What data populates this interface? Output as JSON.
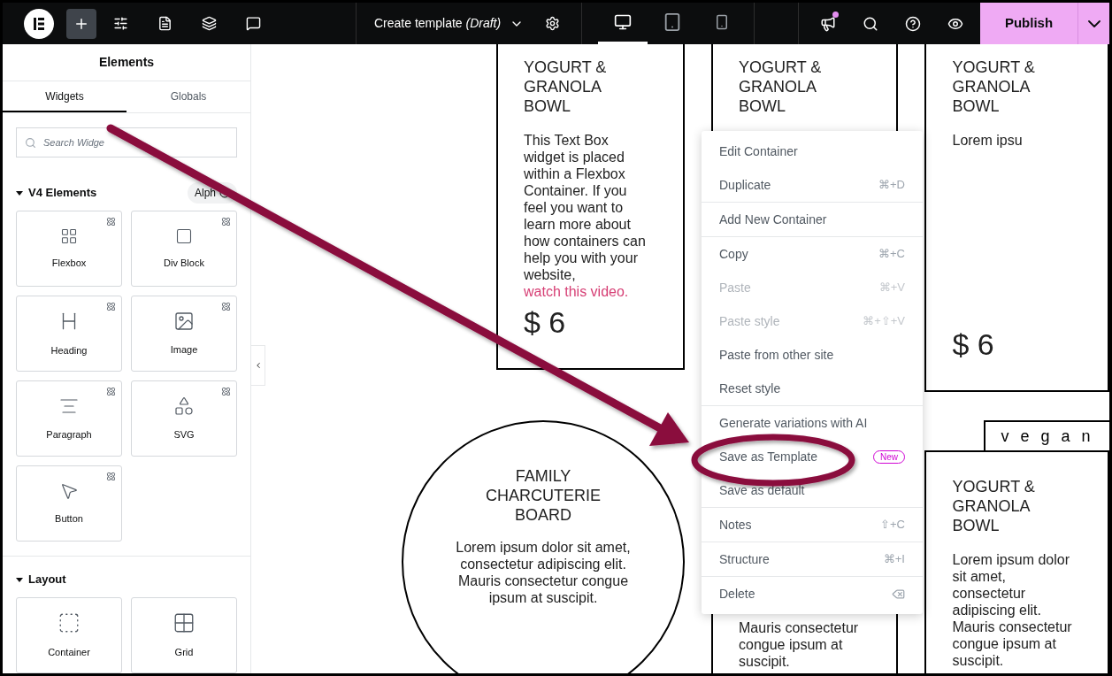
{
  "toolbar": {
    "add_button": {
      "selected": true
    },
    "title": "Create template",
    "status": "(Draft)",
    "devices": [
      {
        "kind": "desktop",
        "selected": true
      },
      {
        "kind": "tablet",
        "selected": false
      },
      {
        "kind": "mobile",
        "selected": false
      }
    ],
    "whats_new": {
      "has_notification": true
    },
    "publish": "Publish"
  },
  "sidebar": {
    "title": "Elements",
    "tabs": [
      {
        "label": "Widgets",
        "selected": true
      },
      {
        "label": "Globals",
        "selected": false
      }
    ],
    "search": {
      "placeholder": "Search Widge"
    },
    "sections": [
      {
        "title": "V4 Elements",
        "expanded": true,
        "badge": "Alph",
        "widgets": [
          {
            "label": "Flexbox",
            "kind": "flexbox",
            "atomic": true
          },
          {
            "label": "Div Block",
            "kind": "div-block",
            "atomic": true
          },
          {
            "label": "Heading",
            "kind": "heading",
            "atomic": true
          },
          {
            "label": "Image",
            "kind": "image",
            "atomic": true
          },
          {
            "label": "Paragraph",
            "kind": "paragraph",
            "atomic": true
          },
          {
            "label": "SVG",
            "kind": "svg",
            "atomic": true
          },
          {
            "label": "Button",
            "kind": "button",
            "atomic": true
          }
        ]
      },
      {
        "title": "Layout",
        "expanded": true,
        "widgets": [
          {
            "label": "Container",
            "kind": "container",
            "atomic": false
          },
          {
            "label": "Grid",
            "kind": "grid",
            "atomic": false
          }
        ]
      }
    ]
  },
  "canvas": {
    "columns": [
      [
        {
          "kind": "card",
          "title": "YOGURT & GRANOLA BOWL",
          "body": "This Text Box widget is placed within a Flexbox Container. If you feel you want to learn more about how containers can help you with your website,",
          "link": "watch this video.",
          "price": "$ 6"
        },
        {
          "kind": "circle",
          "title": "FAMILY CHARCUTERIE BOARD",
          "body": "Lorem ipsum dolor sit amet, consectetur adipiscing elit. Mauris consectetur congue ipsum at suscipit."
        }
      ],
      [
        {
          "kind": "card",
          "title": "YOGURT & GRANOLA BOWL"
        },
        {
          "kind": "card",
          "body": "Mauris consectetur congue ipsum at suscipit."
        }
      ],
      [
        {
          "kind": "card",
          "title": "YOGURT & GRANOLA BOWL",
          "body": "Lorem ipsu",
          "price": "$ 6"
        },
        {
          "kind": "tag",
          "text": "v e g a n"
        },
        {
          "kind": "card",
          "title": "YOGURT & GRANOLA BOWL",
          "body": "Lorem ipsum dolor sit amet, consectetur adipiscing elit. Mauris consectetur congue ipsum at suscipit."
        }
      ]
    ]
  },
  "context_menu": {
    "groups": [
      [
        {
          "label": "Edit Container",
          "disabled": false
        },
        {
          "label": "Duplicate",
          "shortcut": "⌘+D",
          "disabled": false
        }
      ],
      [
        {
          "label": "Add New Container",
          "disabled": false
        }
      ],
      [
        {
          "label": "Copy",
          "shortcut": "⌘+C",
          "disabled": false
        },
        {
          "label": "Paste",
          "shortcut": "⌘+V",
          "disabled": true
        },
        {
          "label": "Paste style",
          "shortcut": "⌘+⇧+V",
          "disabled": true
        },
        {
          "label": "Paste from other site",
          "disabled": false
        },
        {
          "label": "Reset style",
          "disabled": false
        }
      ],
      [
        {
          "label": "Generate variations with AI",
          "disabled": false
        },
        {
          "label": "Save as Template",
          "badge": "New",
          "disabled": false
        },
        {
          "label": "Save as default",
          "disabled": false
        }
      ],
      [
        {
          "label": "Notes",
          "shortcut": "⇧+C",
          "disabled": false
        }
      ],
      [
        {
          "label": "Structure",
          "shortcut": "⌘+I",
          "disabled": false
        }
      ],
      [
        {
          "label": "Delete",
          "kind": "delete",
          "disabled": false
        }
      ]
    ]
  }
}
